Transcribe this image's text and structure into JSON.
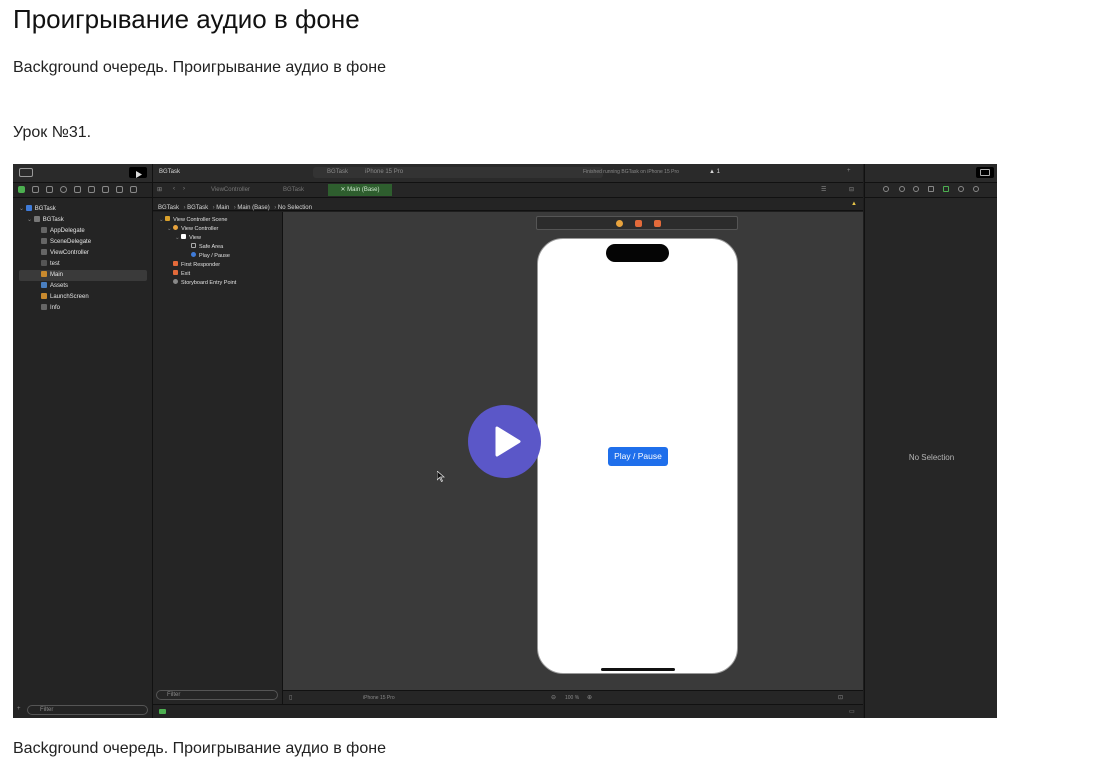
{
  "page": {
    "title": "Проигрывание аудио в фоне",
    "subtitle": "Background очередь. Проигрывание аудио в фоне",
    "lesson": "Урок №31.",
    "footer_text": "Background очередь. Проигрывание аудио в фоне"
  },
  "video": {
    "play_icon": "play-icon",
    "accent_color": "#5b57c8",
    "xcode": {
      "window_title": "BGTask",
      "scheme": "BGTask",
      "device": "iPhone 15 Pro",
      "status": "Finished running BGTask on iPhone 15 Pro",
      "warning_count": "1",
      "tabs": [
        "ViewController",
        "BGTask",
        "Main (Base)"
      ],
      "breadcrumb": [
        "BGTask",
        "BGTask",
        "Main",
        "Main (Base)",
        "No Selection"
      ],
      "navigator": [
        {
          "label": "BGTask",
          "level": 0,
          "icon": "project-icon"
        },
        {
          "label": "BGTask",
          "level": 1,
          "icon": "folder-icon"
        },
        {
          "label": "AppDelegate",
          "level": 2,
          "icon": "swift-file-icon"
        },
        {
          "label": "SceneDelegate",
          "level": 2,
          "icon": "swift-file-icon"
        },
        {
          "label": "ViewController",
          "level": 2,
          "icon": "swift-file-icon"
        },
        {
          "label": "test",
          "level": 2,
          "icon": "audio-file-icon"
        },
        {
          "label": "Main",
          "level": 2,
          "icon": "storyboard-icon"
        },
        {
          "label": "Assets",
          "level": 2,
          "icon": "assets-icon"
        },
        {
          "label": "LaunchScreen",
          "level": 2,
          "icon": "storyboard-icon"
        },
        {
          "label": "Info",
          "level": 2,
          "icon": "plist-icon"
        }
      ],
      "outline": [
        {
          "label": "View Controller Scene",
          "level": 0
        },
        {
          "label": "View Controller",
          "level": 1
        },
        {
          "label": "View",
          "level": 2
        },
        {
          "label": "Safe Area",
          "level": 3
        },
        {
          "label": "Play / Pause",
          "level": 3
        },
        {
          "label": "First Responder",
          "level": 1
        },
        {
          "label": "Exit",
          "level": 1
        },
        {
          "label": "Storyboard Entry Point",
          "level": 1
        }
      ],
      "filter_placeholder": "Filter",
      "device_bottom": "iPhone 15 Pro",
      "zoom": "100 %",
      "canvas_button": "Play / Pause",
      "inspector_empty": "No Selection",
      "colors": {
        "accent": "#1f6feb",
        "active_tab": "#2e5e2e"
      }
    }
  }
}
